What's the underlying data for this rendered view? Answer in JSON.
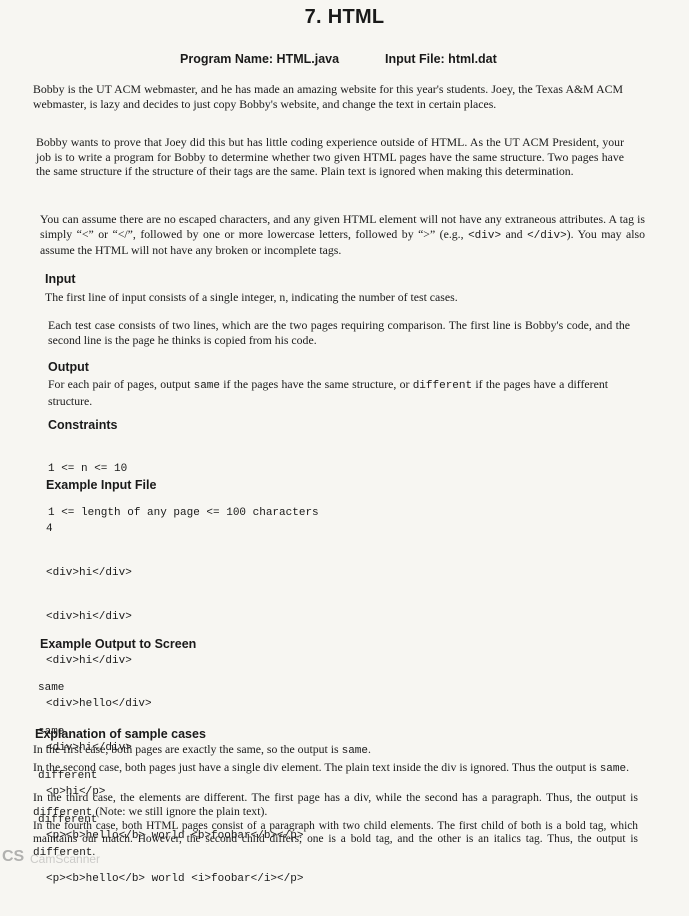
{
  "title": "7. HTML",
  "program_name": "Program Name: HTML.java",
  "input_file": "Input File: html.dat",
  "intro": {
    "p1": "Bobby is the UT ACM webmaster, and he has made an amazing website for this year's students. Joey, the Texas A&M ACM webmaster, is lazy and decides to just copy Bobby's website, and change the text in certain places.",
    "p2": "Bobby wants to prove that Joey did this but has little coding experience outside of HTML. As the UT ACM President, your job is to write a program for Bobby to determine whether two given HTML pages have the same structure. Two pages have the same structure if the structure of their tags are the same. Plain text is ignored when making this determination.",
    "p3_a": "You can assume there are no escaped characters, and any given HTML element will not have any extraneous attributes. A tag is simply “<” or “</”, followed by one or more lowercase letters, followed by “>” (e.g., ",
    "p3_code1": "<div>",
    "p3_and": " and ",
    "p3_code2": "</div>",
    "p3_b": "). You may also assume the HTML will not have any broken or incomplete tags."
  },
  "input": {
    "heading": "Input",
    "p1": "The first line of input consists of a single integer, n, indicating the number of test cases.",
    "p2": "Each test case consists of two lines, which are the two pages requiring comparison. The first line is Bobby's code, and the second line is the page he thinks is copied from his code."
  },
  "output": {
    "heading": "Output",
    "text_a": "For each pair of pages, output ",
    "code_same": "same",
    "text_b": " if the pages have the same structure, or ",
    "code_diff": "different",
    "text_c": " if the pages have a different structure."
  },
  "constraints": {
    "heading": "Constraints",
    "lines": [
      "1 <= n <= 10",
      "1 <= length of any page <= 100 characters"
    ]
  },
  "example_input": {
    "heading": "Example Input File",
    "lines": [
      "4",
      "<div>hi</div>",
      "<div>hi</div>",
      "<div>hi</div>",
      "<div>hello</div>",
      "<div>hi</div>",
      "<p>hi</p>",
      "<p><b>hello</b> world <b>foobar</b></p>",
      "<p><b>hello</b> world <i>foobar</i></p>"
    ]
  },
  "example_output": {
    "heading": "Example Output to Screen",
    "lines": [
      "same",
      "same",
      "different",
      "different"
    ]
  },
  "explanation": {
    "heading": "Explanation of sample cases",
    "c1_a": "In the first case, both pages are exactly the same, so the output is ",
    "c1_code": "same",
    "c1_b": ".",
    "c2_a": "In the second case, both pages just have a single div element. The plain text inside the div is ignored. Thus the output is ",
    "c2_code": "same",
    "c2_b": ".",
    "c3_a": "In the third case, the elements are different. The first page has a div, while the second has a paragraph. Thus, the output is ",
    "c3_code": "different",
    "c3_b": " (Note: we still ignore the plain text).",
    "c4_a": "In the fourth case, both HTML pages consist of a paragraph with two child elements. The first child of both is a bold tag, which maintains our match. However, the second child differs; one is a bold tag, and the other is an italics tag. Thus, the output is ",
    "c4_code": "different",
    "c4_b": "."
  },
  "watermark": {
    "logo": "CS",
    "text": "CamScanner"
  }
}
